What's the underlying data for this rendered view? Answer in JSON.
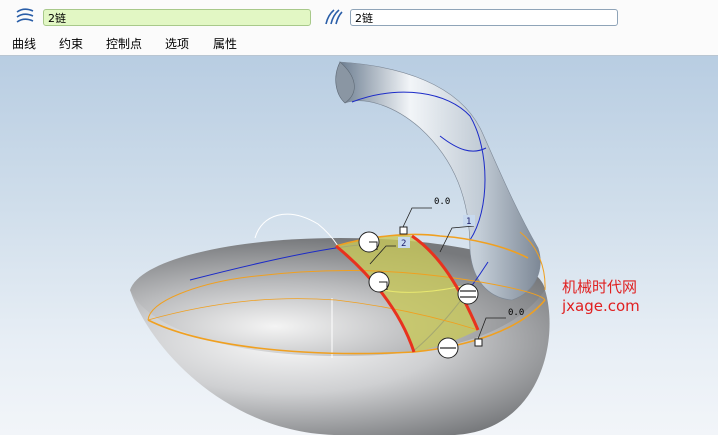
{
  "toolbar": {
    "chain_1_value": "2链",
    "chain_2_value": "2链",
    "chain_1_icon": "boundary-chain-1-icon",
    "chain_2_icon": "boundary-chain-2-icon",
    "active_field_color": "#e2f7c4"
  },
  "menu": {
    "tabs": [
      {
        "label": "曲线"
      },
      {
        "label": "约束"
      },
      {
        "label": "控制点"
      },
      {
        "label": "选项"
      },
      {
        "label": "属性"
      }
    ]
  },
  "viewport": {
    "dimensions": [
      {
        "value": "0.0"
      },
      {
        "value": "0.0"
      }
    ],
    "chain_tags": [
      {
        "label": "1"
      },
      {
        "label": "2"
      }
    ],
    "colors": {
      "edge_highlight": "#e8321e",
      "boundary_chain": "#f0a020",
      "surface_fill": "#c8c85a",
      "curve_blue": "#1c2bc8"
    }
  },
  "watermark": {
    "line1": "机械时代网",
    "line2": "jxage.com"
  }
}
